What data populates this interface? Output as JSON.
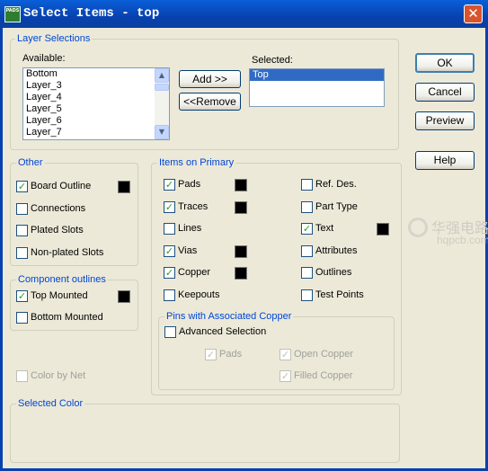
{
  "window": {
    "title": "Select Items - top",
    "app_icon_text": "PADS"
  },
  "layer_selections": {
    "title": "Layer Selections",
    "available_label": "Available:",
    "available_items": [
      "Bottom",
      "Layer_3",
      "Layer_4",
      "Layer_5",
      "Layer_6",
      "Layer_7"
    ],
    "selected_label": "Selected:",
    "selected_items": [
      "Top"
    ],
    "add_button": "Add >>",
    "remove_button": "<<Remove"
  },
  "buttons": {
    "ok": "OK",
    "cancel": "Cancel",
    "preview": "Preview",
    "help": "Help"
  },
  "other": {
    "title": "Other",
    "items": [
      {
        "label": "Board Outline",
        "checked": true,
        "swatch": "#000000"
      },
      {
        "label": "Connections",
        "checked": false
      },
      {
        "label": "Plated Slots",
        "checked": false
      },
      {
        "label": "Non-plated Slots",
        "checked": false
      }
    ]
  },
  "component_outlines": {
    "title": "Component outlines",
    "items": [
      {
        "label": "Top Mounted",
        "checked": true,
        "swatch": "#000000"
      },
      {
        "label": "Bottom Mounted",
        "checked": false
      }
    ]
  },
  "color_by_net": {
    "label": "Color by Net",
    "checked": false,
    "enabled": false
  },
  "items_on_primary": {
    "title": "Items on Primary",
    "left": [
      {
        "label": "Pads",
        "checked": true,
        "swatch": "#000000"
      },
      {
        "label": "Traces",
        "checked": true,
        "swatch": "#000000"
      },
      {
        "label": "Lines",
        "checked": false
      },
      {
        "label": "Vias",
        "checked": true,
        "swatch": "#000000"
      },
      {
        "label": "Copper",
        "checked": true,
        "swatch": "#000000"
      },
      {
        "label": "Keepouts",
        "checked": false
      }
    ],
    "right": [
      {
        "label": "Ref. Des.",
        "checked": false
      },
      {
        "label": "Part Type",
        "checked": false
      },
      {
        "label": "Text",
        "checked": true,
        "swatch": "#000000"
      },
      {
        "label": "Attributes",
        "checked": false
      },
      {
        "label": "Outlines",
        "checked": false
      },
      {
        "label": "Test Points",
        "checked": false
      }
    ]
  },
  "pins_with_copper": {
    "title": "Pins with Associated Copper",
    "advanced": {
      "label": "Advanced Selection",
      "checked": false
    },
    "pads": {
      "label": "Pads",
      "checked": true,
      "enabled": false
    },
    "open_copper": {
      "label": "Open Copper",
      "checked": true,
      "enabled": false
    },
    "filled_copper": {
      "label": "Filled Copper",
      "checked": true,
      "enabled": false
    }
  },
  "selected_color": {
    "title": "Selected Color"
  },
  "watermark": {
    "cn": "华强电路",
    "url": "hqpcb.com"
  },
  "colors": {
    "title_bar": "#0842b0",
    "dialog_bg": "#ece9d8",
    "group_title": "#0046d5",
    "selection": "#316ac5",
    "check": "#21a121"
  }
}
